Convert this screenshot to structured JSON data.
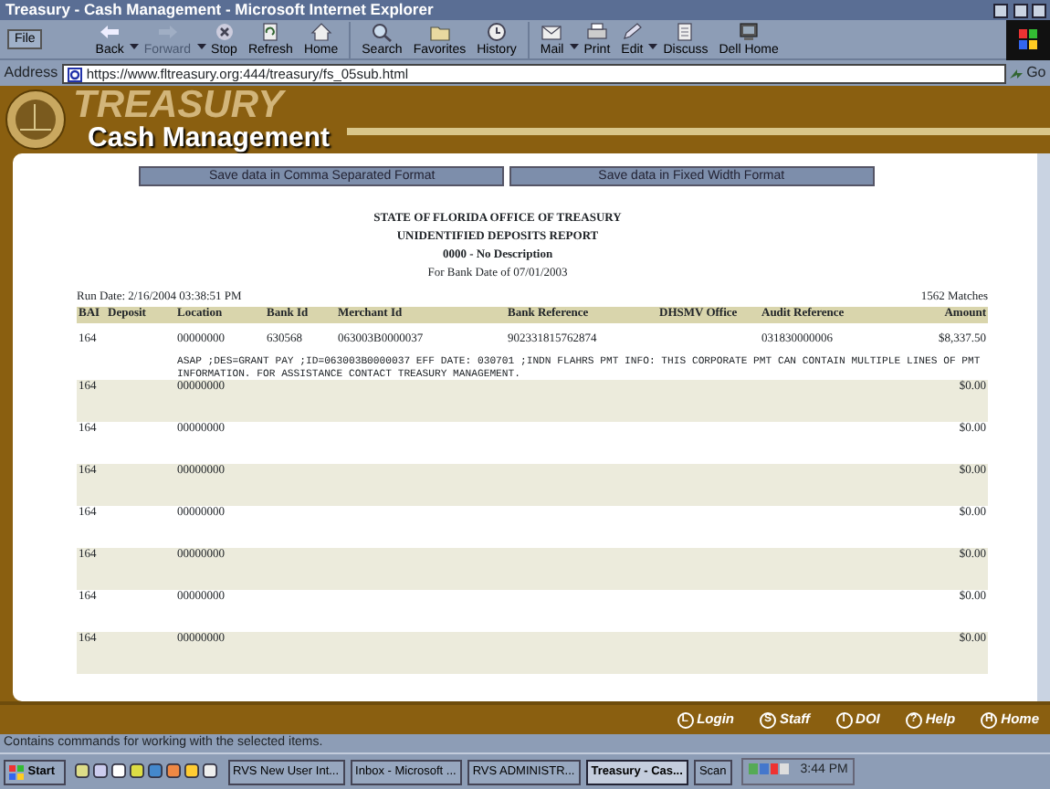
{
  "window": {
    "title": "Treasury - Cash Management - Microsoft Internet Explorer"
  },
  "menu_button": "File",
  "toolbar": [
    {
      "label": "Back",
      "disabled": false,
      "dropdown": true
    },
    {
      "label": "Forward",
      "disabled": true,
      "dropdown": true
    },
    {
      "label": "Stop",
      "disabled": false,
      "dropdown": false
    },
    {
      "label": "Refresh",
      "disabled": false,
      "dropdown": false
    },
    {
      "label": "Home",
      "disabled": false,
      "dropdown": false
    },
    {
      "label": "Search",
      "disabled": false,
      "dropdown": false
    },
    {
      "label": "Favorites",
      "disabled": false,
      "dropdown": false
    },
    {
      "label": "History",
      "disabled": false,
      "dropdown": false
    },
    {
      "label": "Mail",
      "disabled": false,
      "dropdown": true
    },
    {
      "label": "Print",
      "disabled": false,
      "dropdown": false
    },
    {
      "label": "Edit",
      "disabled": false,
      "dropdown": true
    },
    {
      "label": "Discuss",
      "disabled": false,
      "dropdown": false
    },
    {
      "label": "Dell Home",
      "disabled": false,
      "dropdown": false
    }
  ],
  "address": {
    "label": "Address",
    "url": "https://www.fltreasury.org:444/treasury/fs_05sub.html",
    "go": "Go"
  },
  "banner": {
    "watermark": "TREASURY",
    "title": "Cash Management"
  },
  "save_buttons": [
    "Save data in Comma Separated Format",
    "Save data in Fixed Width Format"
  ],
  "report": {
    "heading": [
      "STATE OF FLORIDA OFFICE OF TREASURY",
      "UNIDENTIFIED DEPOSITS REPORT",
      "0000 - No Description"
    ],
    "subheading": "For Bank Date of 07/01/2003",
    "run_date": "Run Date: 2/16/2004 03:38:51 PM",
    "matches": "1562 Matches"
  },
  "table": {
    "columns": [
      "BAI",
      "Deposit",
      "Location",
      "Bank Id",
      "Merchant Id",
      "Bank Reference",
      "DHSMV Office",
      "Audit Reference",
      "Amount"
    ],
    "rows": [
      {
        "cells": [
          "164",
          "",
          "00000000",
          "630568",
          "063003B0000037",
          "902331815762874",
          "",
          "031830000006",
          "$8,337.50"
        ],
        "memo": "ASAP ;DES=GRANT PAY ;ID=063003B0000037 EFF DATE: 030701 ;INDN FLAHRS PMT INFO: THIS CORPORATE PMT CAN CONTAIN MULTIPLE LINES OF PMT INFORMATION. FOR ASSISTANCE CONTACT TREASURY MANAGEMENT."
      },
      {
        "cells": [
          "164",
          "",
          "00000000",
          "",
          "",
          "",
          "",
          "",
          "$0.00"
        ]
      },
      {
        "cells": [
          "164",
          "",
          "00000000",
          "",
          "",
          "",
          "",
          "",
          "$0.00"
        ]
      },
      {
        "cells": [
          "164",
          "",
          "00000000",
          "",
          "",
          "",
          "",
          "",
          "$0.00"
        ]
      },
      {
        "cells": [
          "164",
          "",
          "00000000",
          "",
          "",
          "",
          "",
          "",
          "$0.00"
        ]
      },
      {
        "cells": [
          "164",
          "",
          "00000000",
          "",
          "",
          "",
          "",
          "",
          "$0.00"
        ]
      },
      {
        "cells": [
          "164",
          "",
          "00000000",
          "",
          "",
          "",
          "",
          "",
          "$0.00"
        ]
      },
      {
        "cells": [
          "164",
          "",
          "00000000",
          "",
          "",
          "",
          "",
          "",
          "$0.00"
        ]
      }
    ]
  },
  "footer_links": [
    {
      "icon": "L",
      "label": "Login"
    },
    {
      "icon": "S",
      "label": "Staff"
    },
    {
      "icon": "I",
      "label": "DOI"
    },
    {
      "icon": "?",
      "label": "Help"
    },
    {
      "icon": "H",
      "label": "Home"
    }
  ],
  "status_bar": "Contains commands for working with the selected items.",
  "taskbar": {
    "start": "Start",
    "tasks": [
      {
        "label": "RVS New User Int...",
        "selected": false
      },
      {
        "label": "Inbox - Microsoft ...",
        "selected": false
      },
      {
        "label": "RVS ADMINISTR...",
        "selected": false
      },
      {
        "label": "Treasury - Cas...",
        "selected": true
      },
      {
        "label": "Scan",
        "selected": false
      }
    ],
    "clock": "3:44 PM"
  }
}
